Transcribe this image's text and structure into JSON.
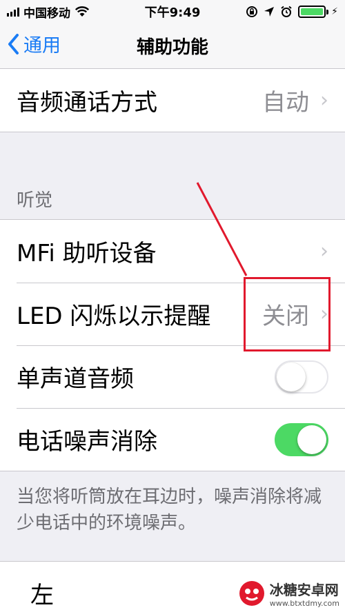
{
  "status_bar": {
    "carrier": "中国移动",
    "time": "下午9:49",
    "battery_level": 1.0
  },
  "nav": {
    "back_label": "通用",
    "title": "辅助功能"
  },
  "top_group": {
    "row_label": "音频通话方式",
    "row_value": "自动"
  },
  "hearing": {
    "header": "听觉",
    "items": [
      {
        "label": "MFi 助听设备",
        "value": ""
      },
      {
        "label": "LED 闪烁以示提醒",
        "value": "关闭"
      },
      {
        "label": "单声道音频",
        "toggle": false
      },
      {
        "label": "电话噪声消除",
        "toggle": true
      }
    ],
    "footer": "当您将听筒放在耳边时，噪声消除将减少电话中的环境噪声。"
  },
  "bottom_row": {
    "label": "左"
  },
  "watermark": {
    "name": "冰糖安卓网",
    "url": "www.btxtdmy.com"
  },
  "colors": {
    "accent": "#1a7cf5",
    "toggle_on": "#4cd964",
    "annotation": "#e1192d",
    "background": "#efeff4"
  },
  "icons": {
    "signal": "signal-icon",
    "wifi": "wifi-icon",
    "rotation_lock": "rotation-lock-icon",
    "location": "location-icon",
    "alarm": "alarm-icon",
    "battery": "battery-icon",
    "charging": "charging-icon",
    "back": "chevron-left-icon",
    "chevron": "chevron-right-icon"
  }
}
